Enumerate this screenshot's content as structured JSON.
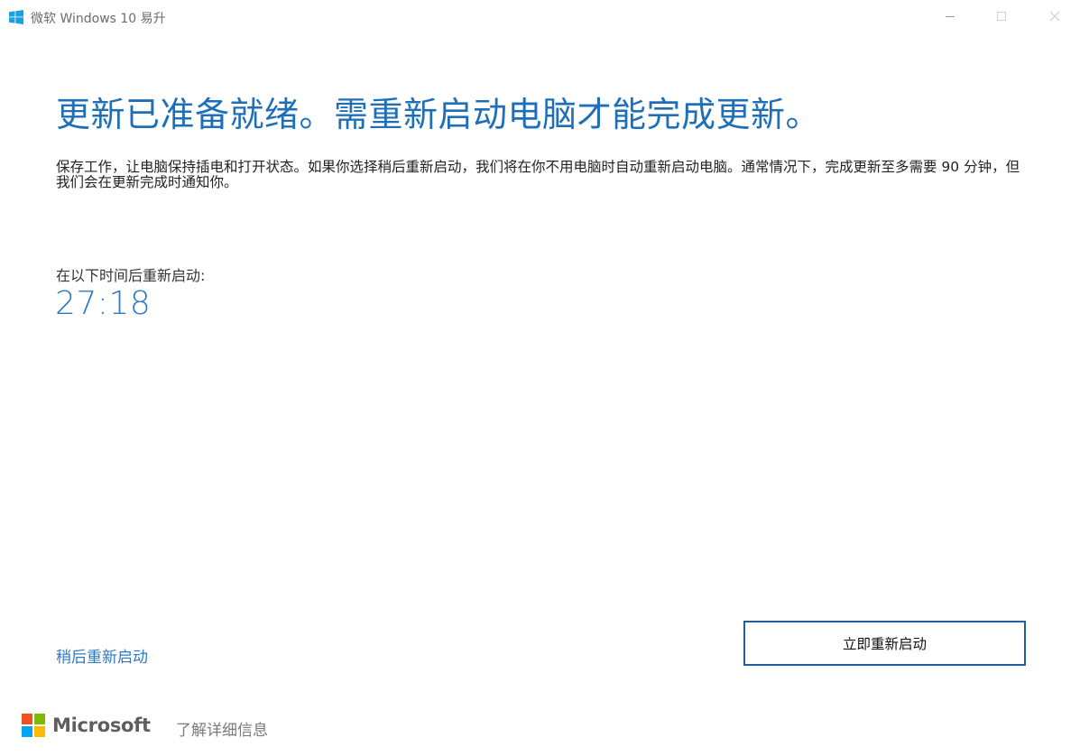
{
  "window": {
    "title": "微软 Windows 10 易升",
    "icon": "windows-logo-icon",
    "controls": {
      "minimize_icon": "minimize-icon",
      "maximize_icon": "maximize-icon",
      "close_icon": "close-icon"
    }
  },
  "main": {
    "heading": "更新已准备就绪。需重新启动电脑才能完成更新。",
    "description": "保存工作，让电脑保持插电和打开状态。如果你选择稍后重新启动，我们将在你不用电脑时自动重新启动电脑。通常情况下，完成更新至多需要 90 分钟，但我们会在更新完成时通知你。",
    "countdown_label": "在以下时间后重新启动:",
    "countdown_value": "27:18"
  },
  "actions": {
    "restart_later": "稍后重新启动",
    "restart_now": "立即重新启动"
  },
  "footer": {
    "brand": "Microsoft",
    "more_info": "了解详细信息"
  },
  "colors": {
    "accent": "#1e6fb8",
    "link": "#2f79c2",
    "button_border": "#1e5fa0",
    "ms_red": "#f25022",
    "ms_green": "#7fba00",
    "ms_blue": "#00a4ef",
    "ms_yellow": "#ffb900",
    "win_logo": "#1ba1e2"
  }
}
